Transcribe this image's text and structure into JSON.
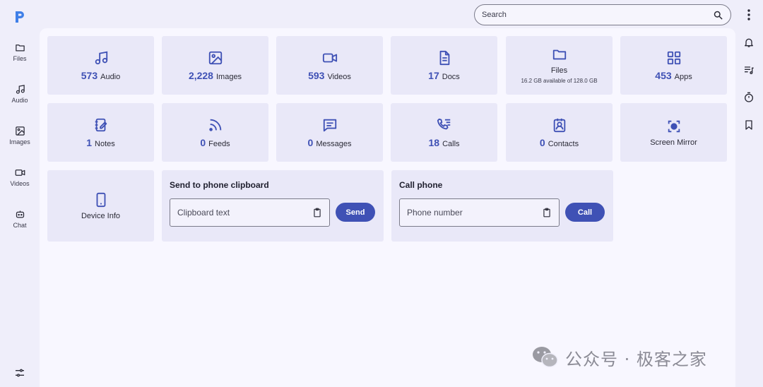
{
  "app": {
    "accent": "#3f51b5",
    "logo_letter": "P"
  },
  "sidebar": {
    "items": [
      {
        "label": "Files",
        "icon": "folder-icon"
      },
      {
        "label": "Audio",
        "icon": "music-note-icon"
      },
      {
        "label": "Images",
        "icon": "image-icon"
      },
      {
        "label": "Videos",
        "icon": "video-camera-icon"
      },
      {
        "label": "Chat",
        "icon": "chat-bot-icon"
      }
    ],
    "settings_icon": "sliders-icon"
  },
  "topbar": {
    "search_placeholder": "Search"
  },
  "right_rail": [
    "bell-icon",
    "playlist-icon",
    "timer-icon",
    "bookmark-icon"
  ],
  "cards": [
    {
      "count": "573",
      "label": "Audio",
      "icon": "music-note-icon"
    },
    {
      "count": "2,228",
      "label": "Images",
      "icon": "image-icon"
    },
    {
      "count": "593",
      "label": "Videos",
      "icon": "video-camera-icon"
    },
    {
      "count": "17",
      "label": "Docs",
      "icon": "document-icon"
    },
    {
      "label": "Files",
      "sub": "16.2 GB available of 128.0 GB",
      "icon": "folder-icon"
    },
    {
      "count": "453",
      "label": "Apps",
      "icon": "apps-grid-icon"
    },
    {
      "count": "1",
      "label": "Notes",
      "icon": "notes-icon"
    },
    {
      "count": "0",
      "label": "Feeds",
      "icon": "rss-icon"
    },
    {
      "count": "0",
      "label": "Messages",
      "icon": "message-icon"
    },
    {
      "count": "18",
      "label": "Calls",
      "icon": "call-list-icon"
    },
    {
      "count": "0",
      "label": "Contacts",
      "icon": "contact-icon"
    },
    {
      "label": "Screen Mirror",
      "icon": "screen-mirror-icon"
    },
    {
      "label": "Device Info",
      "icon": "phone-device-icon"
    }
  ],
  "clipboard_panel": {
    "title": "Send to phone clipboard",
    "placeholder": "Clipboard text",
    "button": "Send"
  },
  "call_panel": {
    "title": "Call phone",
    "placeholder": "Phone number",
    "button": "Call"
  },
  "watermark": "公众号 · 极客之家"
}
